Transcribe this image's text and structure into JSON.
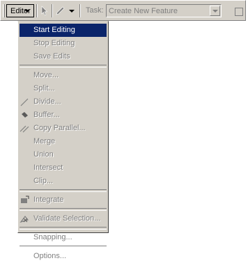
{
  "toolbar": {
    "editor_label": "Editor",
    "task_label": "Task:",
    "task_value": "Create New Feature"
  },
  "menu": {
    "items": [
      {
        "label": "Start Editing",
        "enabled": true,
        "active": true
      },
      {
        "label": "Stop Editing",
        "enabled": false
      },
      {
        "label": "Save Edits",
        "enabled": false
      },
      {
        "label": "Move...",
        "enabled": false
      },
      {
        "label": "Split...",
        "enabled": false
      },
      {
        "label": "Divide...",
        "enabled": false,
        "icon": "divide-icon"
      },
      {
        "label": "Buffer...",
        "enabled": false,
        "icon": "buffer-icon"
      },
      {
        "label": "Copy Parallel...",
        "enabled": false,
        "icon": "copy-parallel-icon"
      },
      {
        "label": "Merge",
        "enabled": false
      },
      {
        "label": "Union",
        "enabled": false
      },
      {
        "label": "Intersect",
        "enabled": false
      },
      {
        "label": "Clip...",
        "enabled": false
      },
      {
        "label": "Integrate",
        "enabled": false,
        "icon": "integrate-icon"
      },
      {
        "label": "Validate Selection...",
        "enabled": false,
        "icon": "validate-icon"
      },
      {
        "label": "Snapping...",
        "enabled": false
      },
      {
        "label": "Options...",
        "enabled": false
      }
    ]
  },
  "colors": {
    "menu_bg": "#d4d0c8",
    "highlight": "#0a246a",
    "disabled_text": "#808080"
  }
}
